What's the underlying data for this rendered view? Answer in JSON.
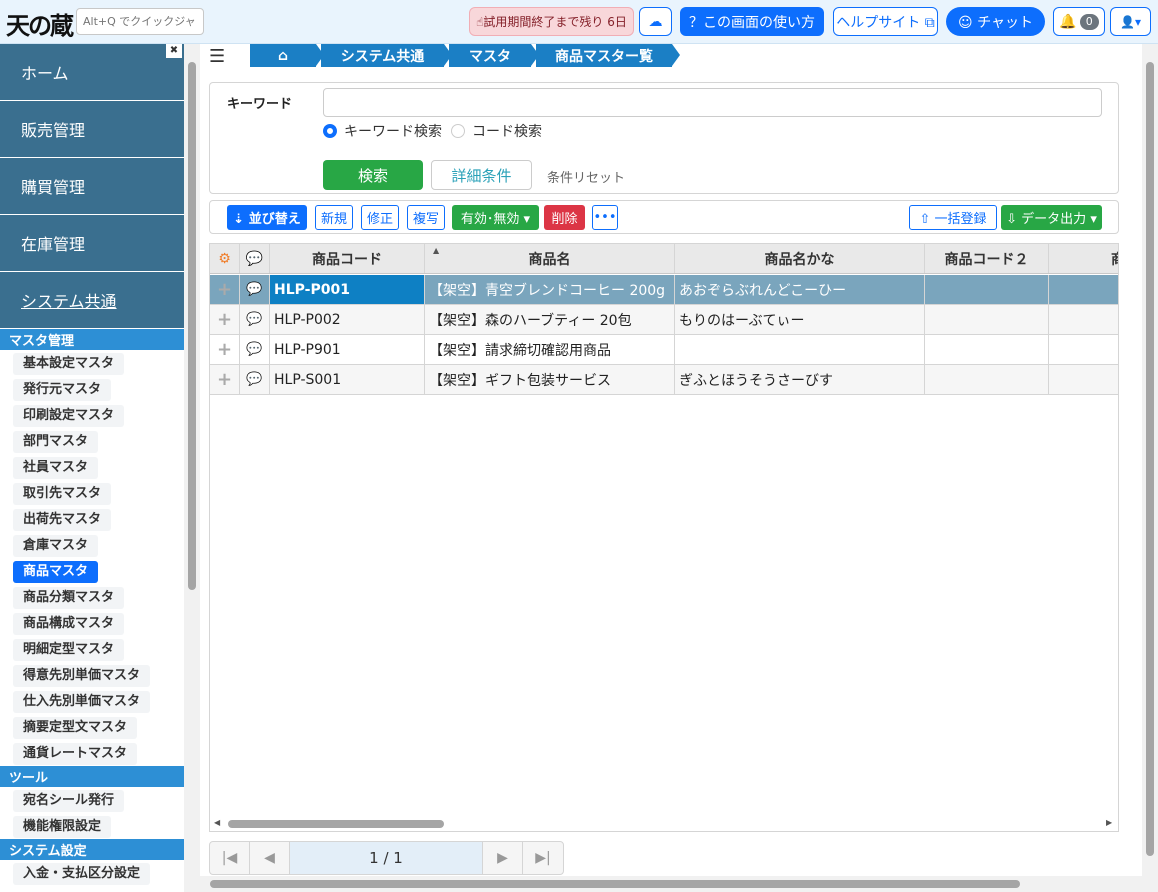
{
  "app": {
    "logo": "天の蔵",
    "quickjump_placeholder": "Alt+Q でクイックジャンプ"
  },
  "header": {
    "trial": "☝試用期間終了まで残り 6日",
    "download_icon": "☁",
    "howto": "？この画面の使い方",
    "helpsite": "ヘルプサイト ⧉",
    "chat": "☺ チャット",
    "bell_icon": "🔔",
    "notif_count": "0",
    "user_icon": "👤▾"
  },
  "sidebar": {
    "main": [
      "ホーム",
      "販売管理",
      "購買管理",
      "在庫管理",
      "システム共通"
    ],
    "section_master": "マスタ管理",
    "master_items": [
      "基本設定マスタ",
      "発行元マスタ",
      "印刷設定マスタ",
      "部門マスタ",
      "社員マスタ",
      "取引先マスタ",
      "出荷先マスタ",
      "倉庫マスタ",
      "商品マスタ",
      "商品分類マスタ",
      "商品構成マスタ",
      "明細定型マスタ",
      "得意先別単価マスタ",
      "仕入先別単価マスタ",
      "摘要定型文マスタ",
      "通貨レートマスタ"
    ],
    "active_item": "商品マスタ",
    "section_tools": "ツール",
    "tool_items": [
      "宛名シール発行",
      "機能権限設定"
    ],
    "section_settings": "システム設定",
    "settings_items": [
      "入金・支払区分設定"
    ]
  },
  "breadcrumb": [
    "⌂",
    "システム共通",
    "マスタ",
    "商品マスター覧"
  ],
  "search": {
    "keyword_label": "キーワード",
    "keyword_value": "",
    "radio_keyword": "キーワード検索",
    "radio_code": "コード検索",
    "search_button": "検索",
    "detail_button": "詳細条件",
    "reset_link": "条件リセット"
  },
  "toolbar": {
    "sort": "⇣ 並び替え",
    "new": "新規",
    "edit": "修正",
    "copy": "複写",
    "valid": "有効･無効 ▾",
    "delete": "削除",
    "more": "•••",
    "bulk": "⇧ 一括登録",
    "export": "⇩ データ出力 ▾"
  },
  "grid": {
    "gear_icon": "⚙",
    "comment_icon": "💬",
    "columns": [
      "商品コード",
      "商品名",
      "商品名かな",
      "商品コード２",
      "商"
    ],
    "rows": [
      {
        "code": "HLP-P001",
        "name": "【架空】青空ブレンドコーヒー 200g",
        "kana": "あおぞらぶれんどこーひー",
        "code2": ""
      },
      {
        "code": "HLP-P002",
        "name": "【架空】森のハーブティー 20包",
        "kana": "もりのはーぶてぃー",
        "code2": ""
      },
      {
        "code": "HLP-P901",
        "name": "【架空】請求締切確認用商品",
        "kana": "",
        "code2": ""
      },
      {
        "code": "HLP-S001",
        "name": "【架空】ギフト包装サービス",
        "kana": "ぎふとほうそうさーびす",
        "code2": ""
      }
    ],
    "row_add_icon": "+",
    "row_comment_icon": "💬"
  },
  "pager": {
    "first": "|◀",
    "prev": "◀",
    "info": "1 / 1",
    "next": "▶",
    "last": "▶|"
  }
}
